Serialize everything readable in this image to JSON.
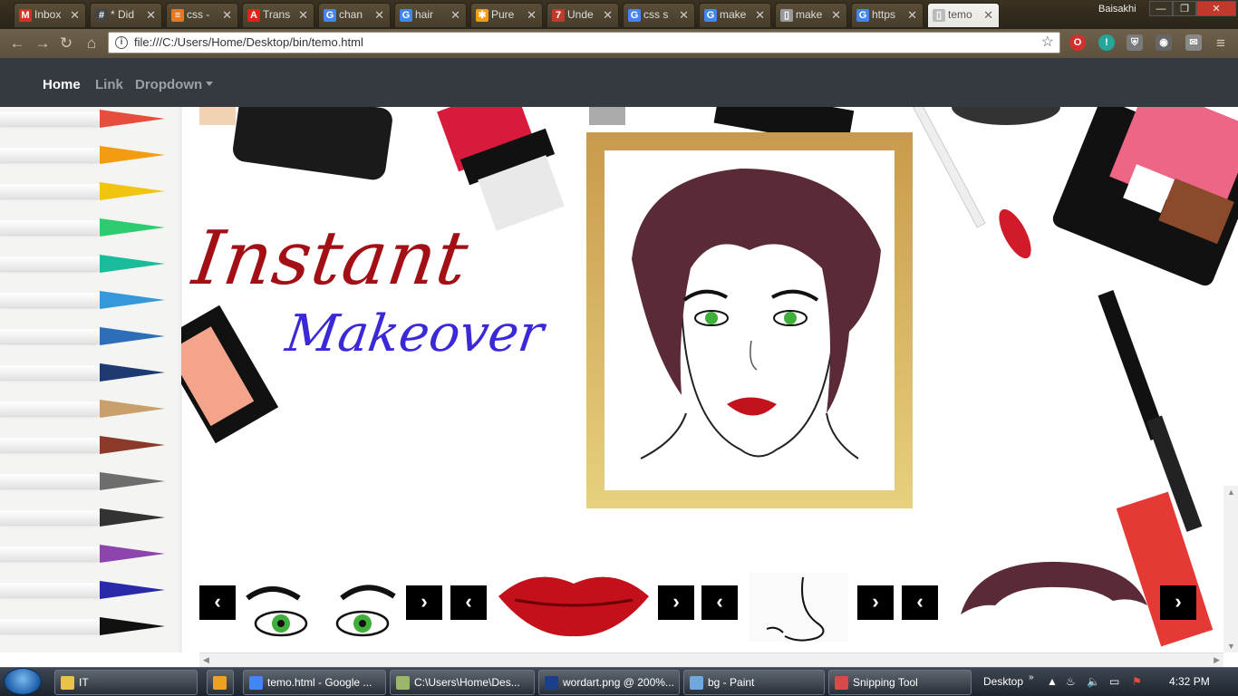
{
  "browser": {
    "tabs": [
      {
        "title": "Inbox",
        "icon": "gmail-icon",
        "color": "#d93025",
        "glyph": "M"
      },
      {
        "title": "* Did",
        "icon": "hash-icon",
        "color": "#444",
        "glyph": "#"
      },
      {
        "title": "css -",
        "icon": "stack-icon",
        "color": "#e87722",
        "glyph": "≡"
      },
      {
        "title": "Trans",
        "icon": "adobe-icon",
        "color": "#e2231a",
        "glyph": "A"
      },
      {
        "title": "chan",
        "icon": "google-icon",
        "color": "#4285f4",
        "glyph": "G"
      },
      {
        "title": "hair",
        "icon": "google-icon",
        "color": "#4285f4",
        "glyph": "G"
      },
      {
        "title": "Pure",
        "icon": "pure-icon",
        "color": "#f39c12",
        "glyph": "✱"
      },
      {
        "title": "Unde",
        "icon": "site-icon",
        "color": "#c0392b",
        "glyph": "7"
      },
      {
        "title": "css s",
        "icon": "google-icon",
        "color": "#4285f4",
        "glyph": "G"
      },
      {
        "title": "make",
        "icon": "google-icon",
        "color": "#4285f4",
        "glyph": "G"
      },
      {
        "title": "make",
        "icon": "document-icon",
        "color": "#999",
        "glyph": "▯"
      },
      {
        "title": "https",
        "icon": "google-icon",
        "color": "#4285f4",
        "glyph": "G"
      },
      {
        "title": "temo",
        "icon": "document-icon",
        "color": "#bbb",
        "glyph": "▯"
      }
    ],
    "user": "Baisakhi",
    "url": "file:///C:/Users/Home/Desktop/bin/temo.html"
  },
  "navbar": {
    "home": "Home",
    "link": "Link",
    "dropdown": "Dropdown"
  },
  "hero": {
    "title_line1": "Instant",
    "title_line2": "Makeover"
  },
  "controls": {
    "prev": "‹",
    "next": "›"
  },
  "taskbar": {
    "items": [
      {
        "label": "IT",
        "icon": "folder-icon",
        "color": "#e8c34a"
      },
      {
        "label": "",
        "icon": "media-player-icon",
        "color": "#f0a020"
      },
      {
        "label": "temo.html - Google ...",
        "icon": "chrome-icon",
        "color": "#4285f4"
      },
      {
        "label": "C:\\Users\\Home\\Des...",
        "icon": "notepad-icon",
        "color": "#9bb86a"
      },
      {
        "label": "wordart.png @ 200%...",
        "icon": "photoshop-icon",
        "color": "#1c3f8c"
      },
      {
        "label": "bg - Paint",
        "icon": "paint-icon",
        "color": "#6fa8dc"
      },
      {
        "label": "Snipping Tool",
        "icon": "scissors-icon",
        "color": "#d84a4a"
      }
    ],
    "desktop": "Desktop",
    "time": "4:32 PM"
  },
  "colors": {
    "navbar_bg": "#343a40",
    "title1": "#a21016",
    "title2": "#3b28d6",
    "frame_top": "#c99a4c",
    "frame_bottom": "#e6d07e"
  }
}
